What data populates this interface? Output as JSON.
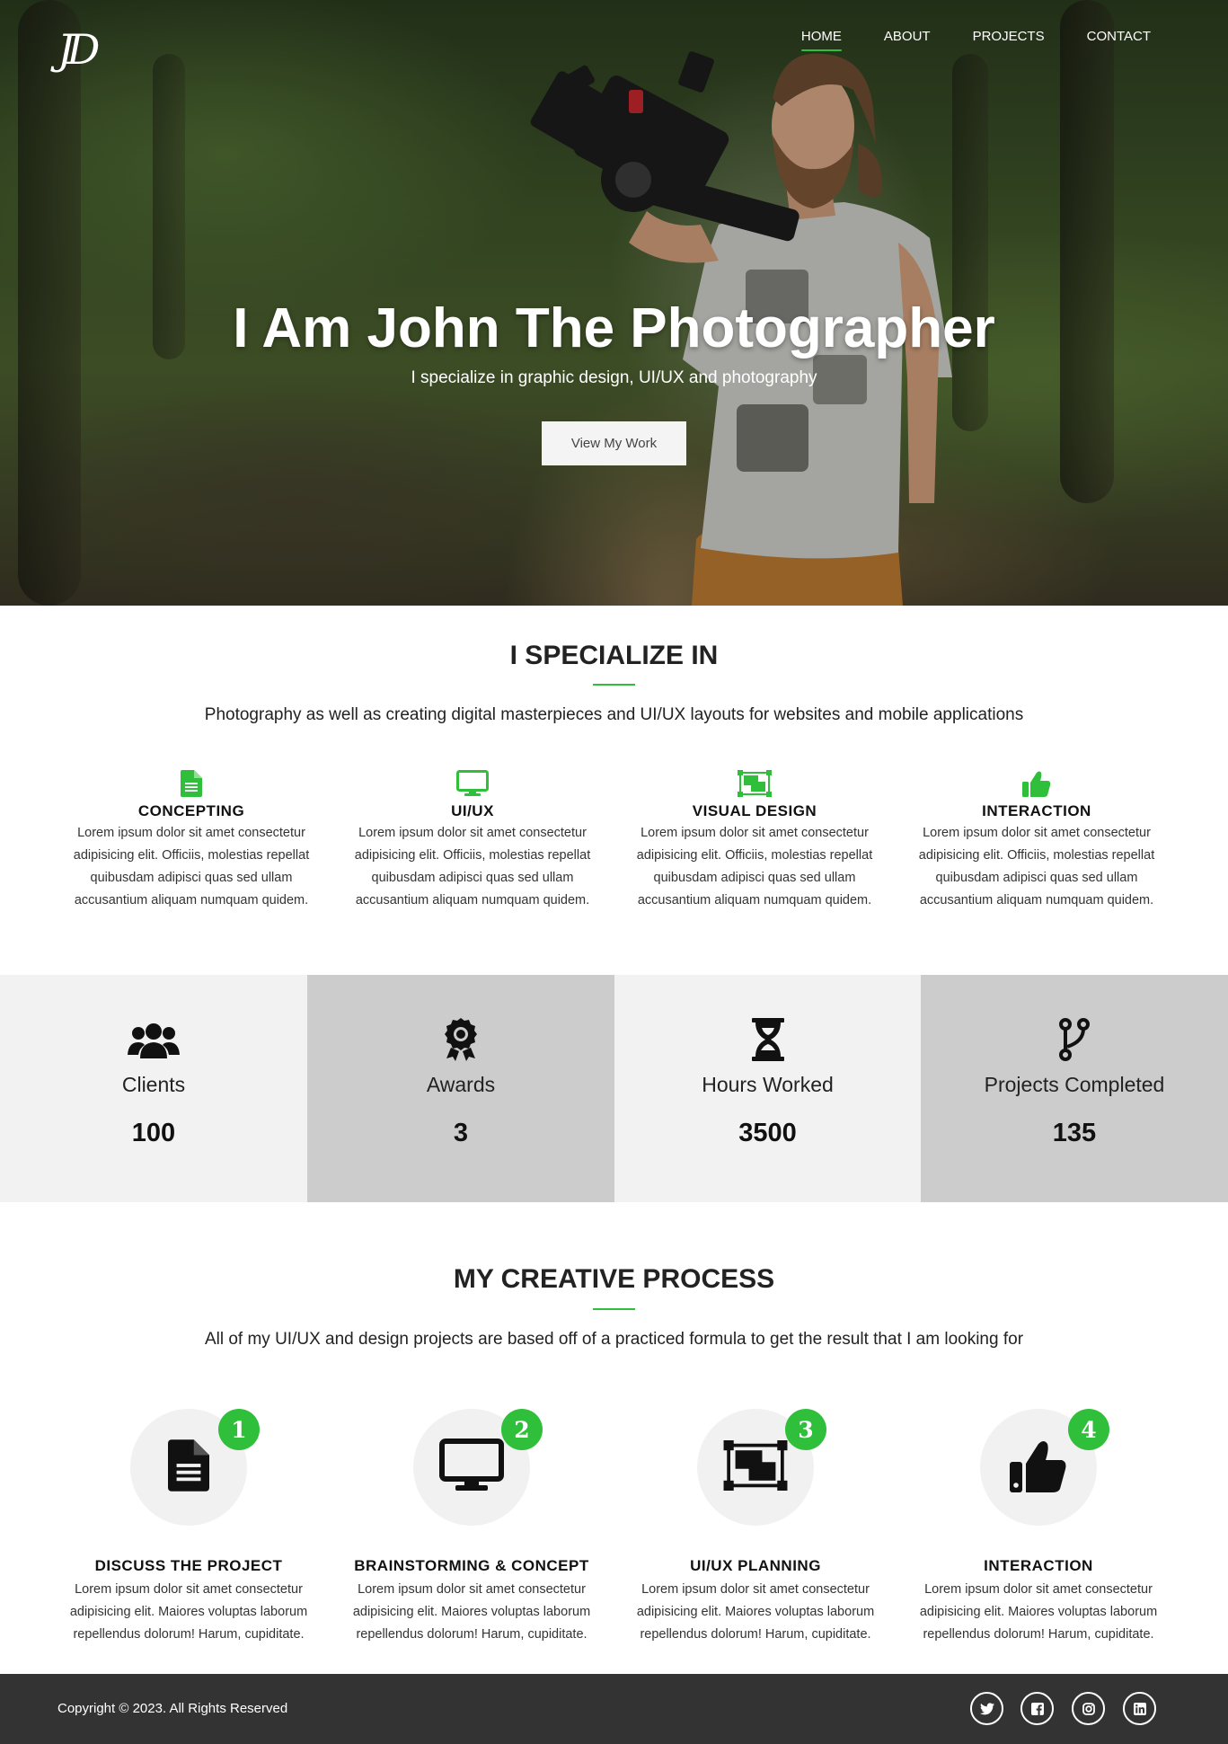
{
  "brand": {
    "logo_text": "JD"
  },
  "nav": {
    "items": [
      {
        "label": "HOME",
        "active": true
      },
      {
        "label": "ABOUT",
        "active": false
      },
      {
        "label": "PROJECTS",
        "active": false
      },
      {
        "label": "CONTACT",
        "active": false
      }
    ]
  },
  "hero": {
    "title": "I Am John The Photographer",
    "subtitle": "I specialize in graphic design, UI/UX and photography",
    "cta_label": "View My Work"
  },
  "specialize": {
    "title": "I SPECIALIZE IN",
    "description": "Photography as well as creating digital masterpieces and UI/UX layouts for websites and mobile applications",
    "items": [
      {
        "icon": "file-icon",
        "title": "CONCEPTING",
        "text": "Lorem ipsum dolor sit amet consectetur adipisicing elit. Officiis, molestias repellat quibusdam adipisci quas sed ullam accusantium aliquam numquam quidem."
      },
      {
        "icon": "desktop-icon",
        "title": "UI/UX",
        "text": "Lorem ipsum dolor sit amet consectetur adipisicing elit. Officiis, molestias repellat quibusdam adipisci quas sed ullam accusantium aliquam numquam quidem."
      },
      {
        "icon": "object-group-icon",
        "title": "VISUAL DESIGN",
        "text": "Lorem ipsum dolor sit amet consectetur adipisicing elit. Officiis, molestias repellat quibusdam adipisci quas sed ullam accusantium aliquam numquam quidem."
      },
      {
        "icon": "thumbs-up-icon",
        "title": "INTERACTION",
        "text": "Lorem ipsum dolor sit amet consectetur adipisicing elit. Officiis, molestias repellat quibusdam adipisci quas sed ullam accusantium aliquam numquam quidem."
      }
    ]
  },
  "stats": [
    {
      "icon": "users-icon",
      "label": "Clients",
      "value": "100"
    },
    {
      "icon": "award-icon",
      "label": "Awards",
      "value": "3"
    },
    {
      "icon": "hourglass-icon",
      "label": "Hours Worked",
      "value": "3500"
    },
    {
      "icon": "code-branch-icon",
      "label": "Projects Completed",
      "value": "135"
    }
  ],
  "process": {
    "title": "MY CREATIVE PROCESS",
    "description": "All of my UI/UX and design projects are based off of a practiced formula to get the result that I am looking for",
    "steps": [
      {
        "number": "1",
        "icon": "file-icon",
        "title": "DISCUSS THE PROJECT",
        "text": "Lorem ipsum dolor sit amet consectetur adipisicing elit. Maiores voluptas laborum repellendus dolorum! Harum, cupiditate."
      },
      {
        "number": "2",
        "icon": "desktop-icon",
        "title": "BRAINSTORMING & CONCEPT",
        "text": "Lorem ipsum dolor sit amet consectetur adipisicing elit. Maiores voluptas laborum repellendus dolorum! Harum, cupiditate."
      },
      {
        "number": "3",
        "icon": "object-group-icon",
        "title": "UI/UX PLANNING",
        "text": "Lorem ipsum dolor sit amet consectetur adipisicing elit. Maiores voluptas laborum repellendus dolorum! Harum, cupiditate."
      },
      {
        "number": "4",
        "icon": "thumbs-up-icon",
        "title": "INTERACTION",
        "text": "Lorem ipsum dolor sit amet consectetur adipisicing elit. Maiores voluptas laborum repellendus dolorum! Harum, cupiditate."
      }
    ]
  },
  "footer": {
    "copyright": "Copyright © 2023. All Rights Reserved",
    "social": [
      "twitter-icon",
      "facebook-icon",
      "instagram-icon",
      "linkedin-icon"
    ]
  },
  "colors": {
    "accent": "#2fbf3a",
    "footer_bg": "#333333",
    "stat_light": "#f2f2f2",
    "stat_dark": "#cccccc"
  }
}
